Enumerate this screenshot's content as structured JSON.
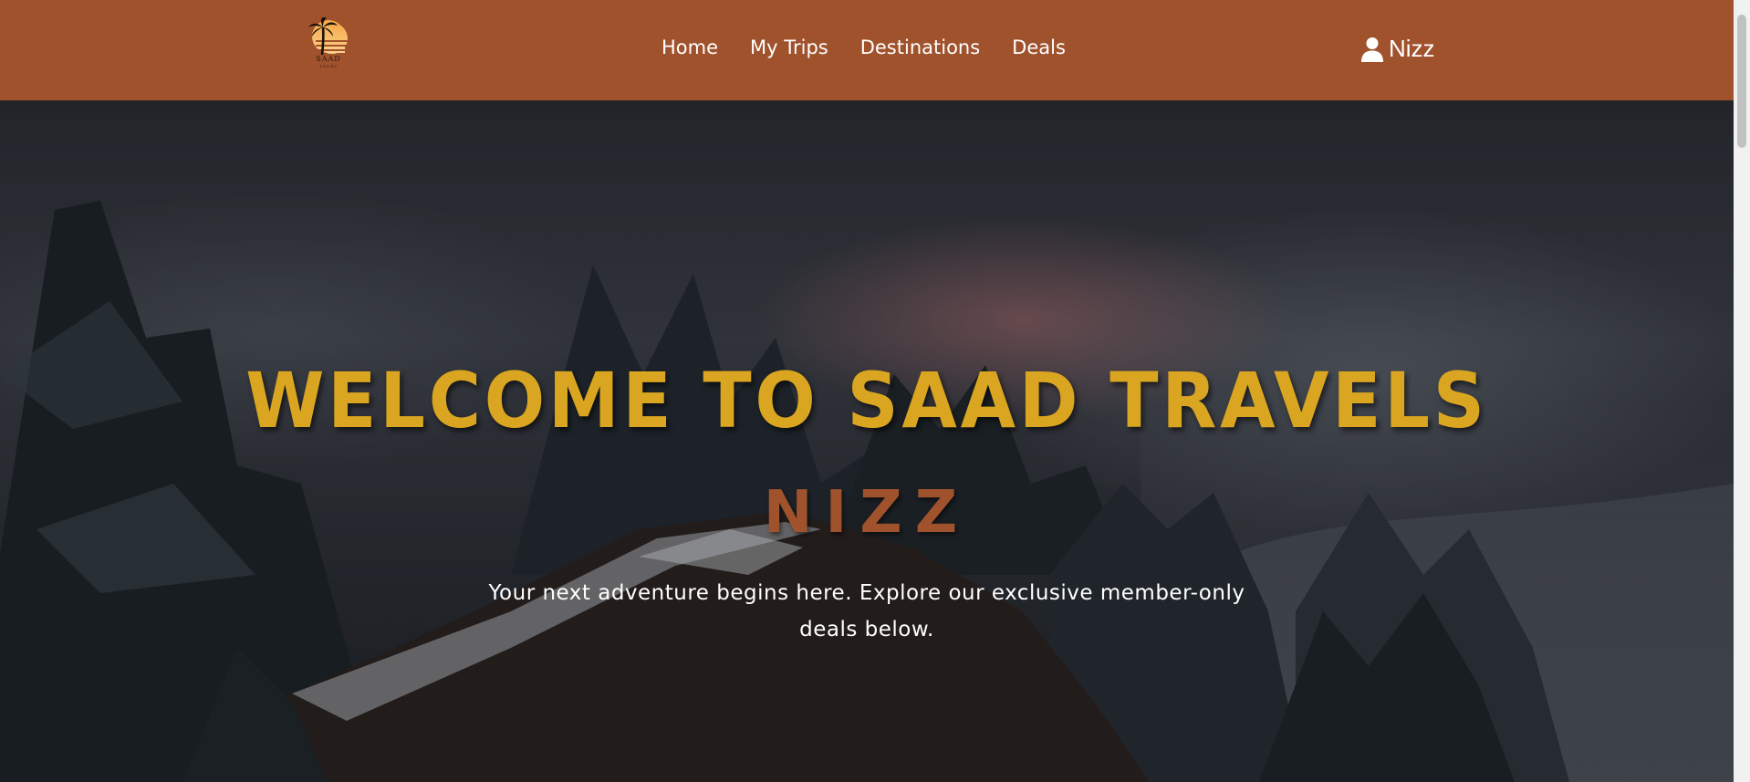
{
  "brand": {
    "logo_text": "SAAD",
    "logo_subtext": "TOURS"
  },
  "nav": {
    "links": [
      "Home",
      "My Trips",
      "Destinations",
      "Deals"
    ]
  },
  "user": {
    "name": "Nizz",
    "icon": "user-icon"
  },
  "hero": {
    "title": "WELCOME TO SAAD TRAVELS",
    "username": "NIZZ",
    "subtitle": "Your next adventure begins here. Explore our exclusive member-only deals below."
  },
  "colors": {
    "navbar": "#a0522d",
    "title": "#daa520",
    "username": "#a0522d",
    "text": "#ffffff"
  }
}
